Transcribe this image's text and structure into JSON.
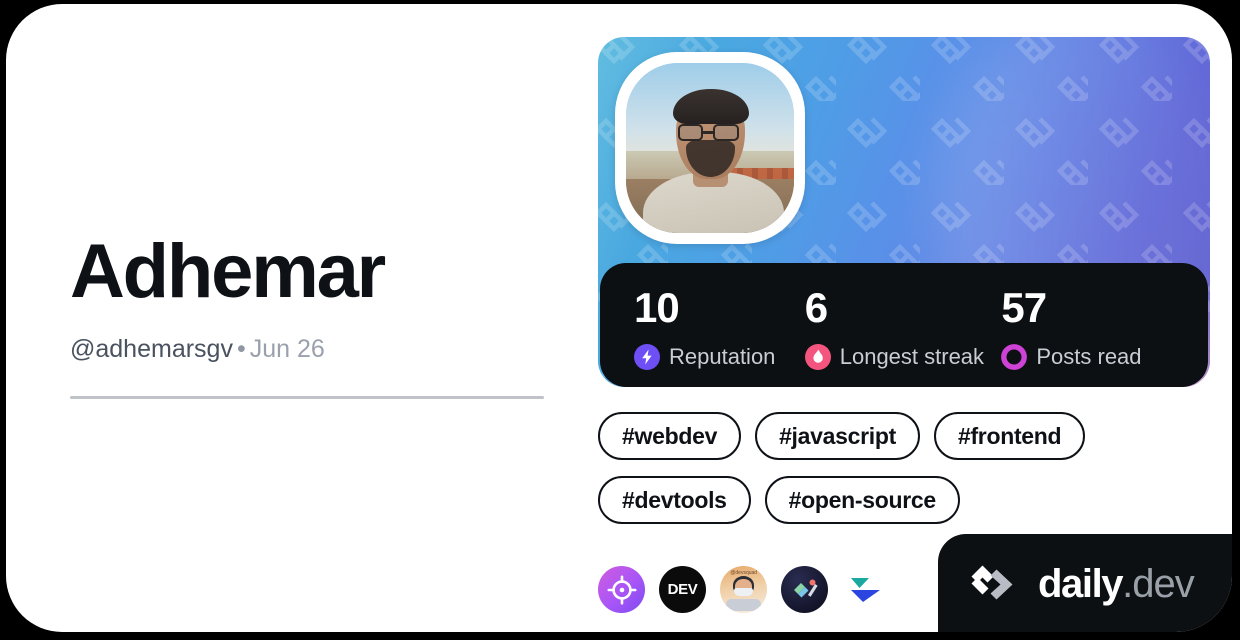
{
  "profile": {
    "display_name": "Adhemar",
    "handle": "@adhemarsgv",
    "separator": "•",
    "joined": "Jun 26",
    "avatar_alt": "profile-photo"
  },
  "stats": [
    {
      "value": "10",
      "label": "Reputation",
      "icon": "reputation-bolt-icon",
      "color": "#6e4ff6"
    },
    {
      "value": "6",
      "label": "Longest streak",
      "icon": "streak-flame-icon",
      "color": "#f4557f"
    },
    {
      "value": "57",
      "label": "Posts read",
      "icon": "posts-read-ring-icon",
      "color": "#cf42d6"
    }
  ],
  "tags": [
    {
      "label": "#webdev"
    },
    {
      "label": "#javascript"
    },
    {
      "label": "#frontend"
    },
    {
      "label": "#devtools"
    },
    {
      "label": "#open-source"
    }
  ],
  "sources": [
    {
      "name": "source-target-icon",
      "label": ""
    },
    {
      "name": "source-dev-icon",
      "label": "DEV"
    },
    {
      "name": "source-avatar-icon",
      "label": "@devsquad"
    },
    {
      "name": "source-dark-icon",
      "label": ""
    },
    {
      "name": "source-play-icon",
      "label": ""
    }
  ],
  "brand": {
    "name": "daily",
    "suffix": ".dev",
    "logo": "daily-dev-logo"
  },
  "theme": {
    "card_background": "#ffffff",
    "page_background": "#000000",
    "text_primary": "#0e1217",
    "text_secondary": "#4a5260",
    "text_muted": "#9aa1ad",
    "panel_dark": "#0c1013",
    "cover_gradient_start": "#62bde0",
    "cover_gradient_end": "#6563cf"
  }
}
